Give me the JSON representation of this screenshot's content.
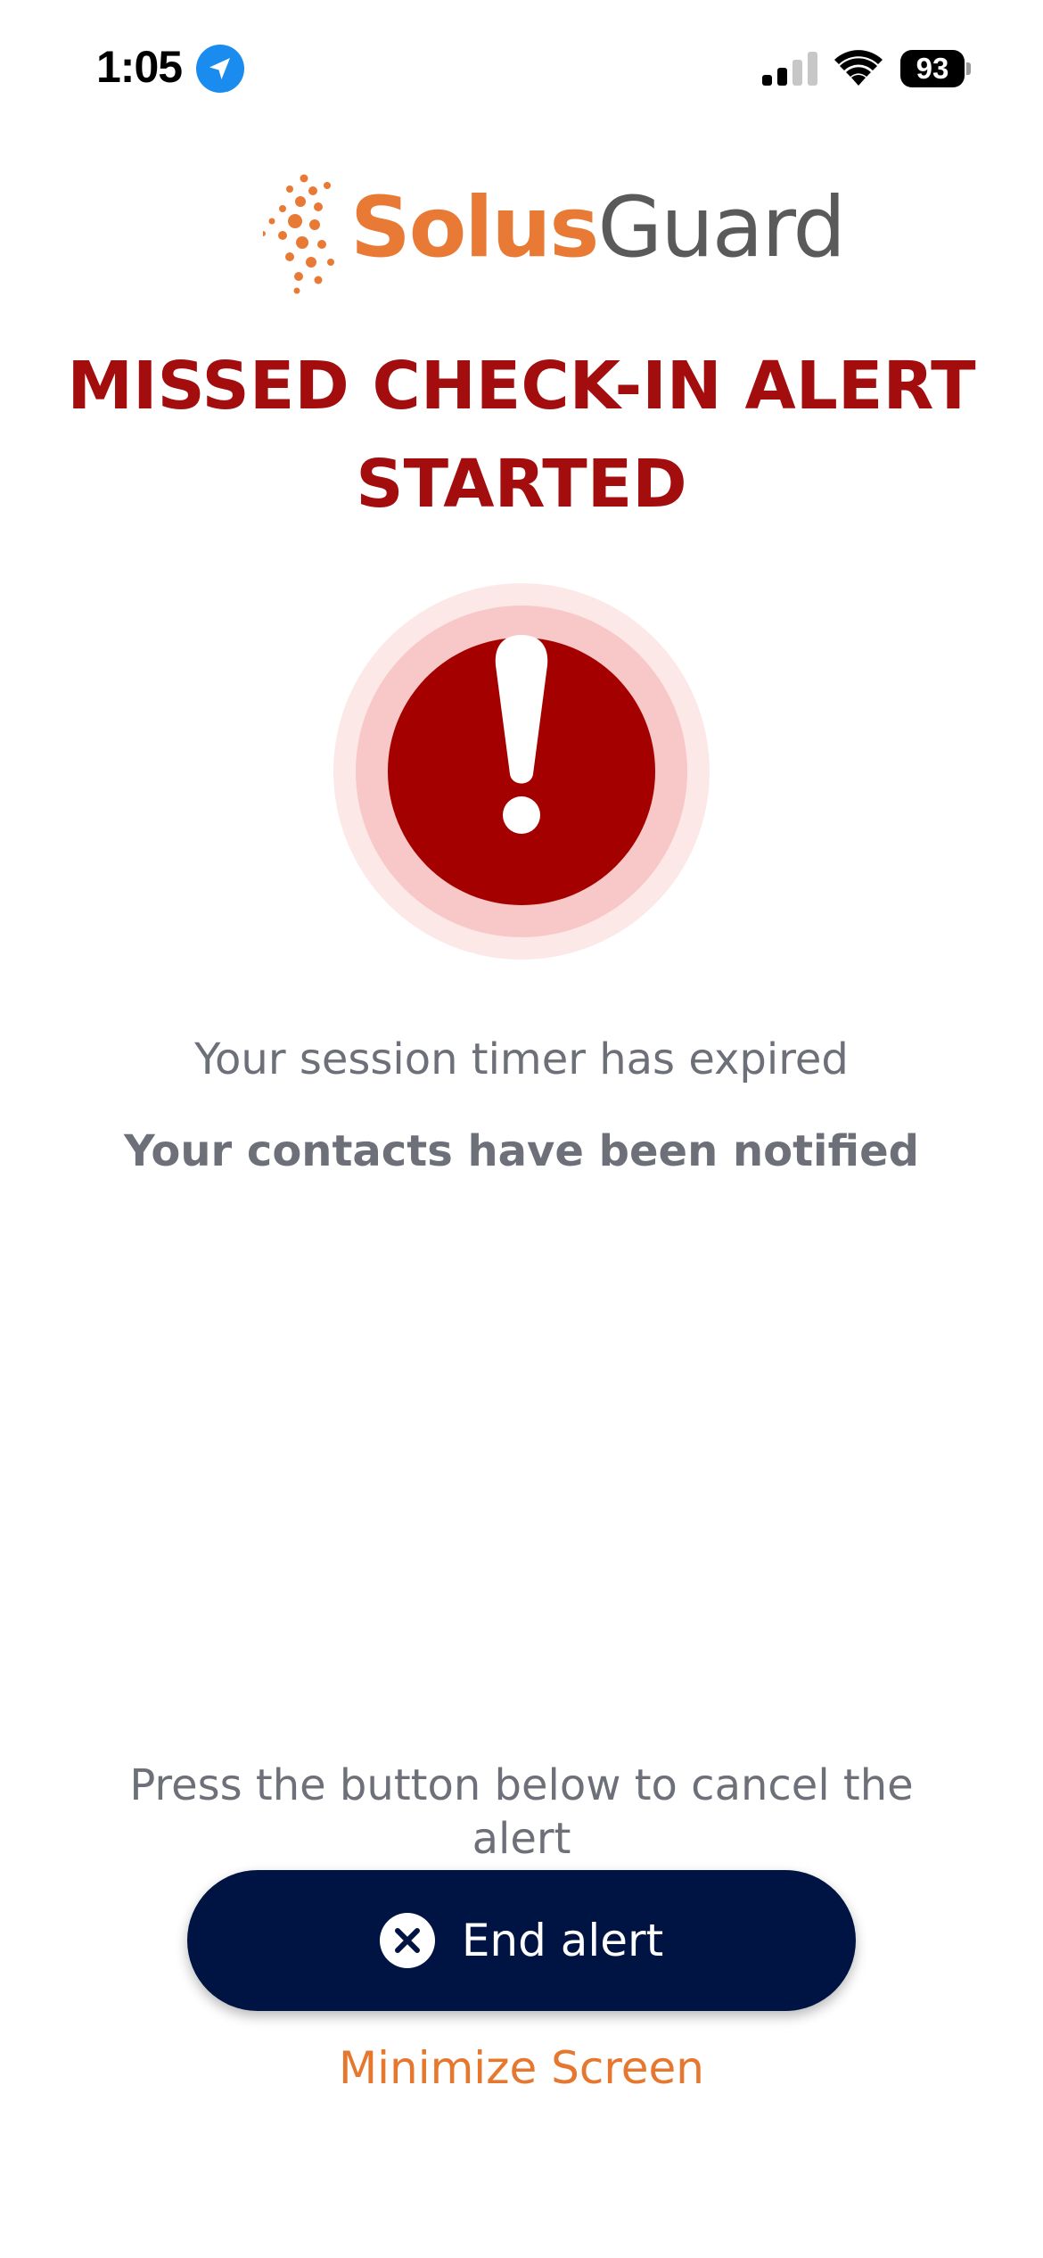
{
  "status_bar": {
    "time": "1:05",
    "battery_level": "93",
    "icons": [
      "location-arrow-icon",
      "cellular-signal-icon",
      "wifi-icon",
      "battery-icon"
    ]
  },
  "logo": {
    "part1": "Solus",
    "part2": "Guard",
    "colors": {
      "solus": "#e87a36",
      "guard": "#5a5a5a"
    }
  },
  "alert": {
    "title_line1": "MISSED CHECK-IN ALERT",
    "title_line2": "STARTED",
    "icon": "exclamation-alert-icon",
    "title_color": "#a30d0d",
    "icon_color": "#a50000"
  },
  "messages": {
    "expired": "Your session timer has expired",
    "notified": "Your contacts have been notified",
    "instruction": "Press the button below to cancel the alert"
  },
  "actions": {
    "end_alert_label": "End alert",
    "end_alert_icon": "close-circle-icon",
    "end_alert_color": "#001444",
    "minimize_label": "Minimize Screen",
    "minimize_color": "#e5772f"
  }
}
